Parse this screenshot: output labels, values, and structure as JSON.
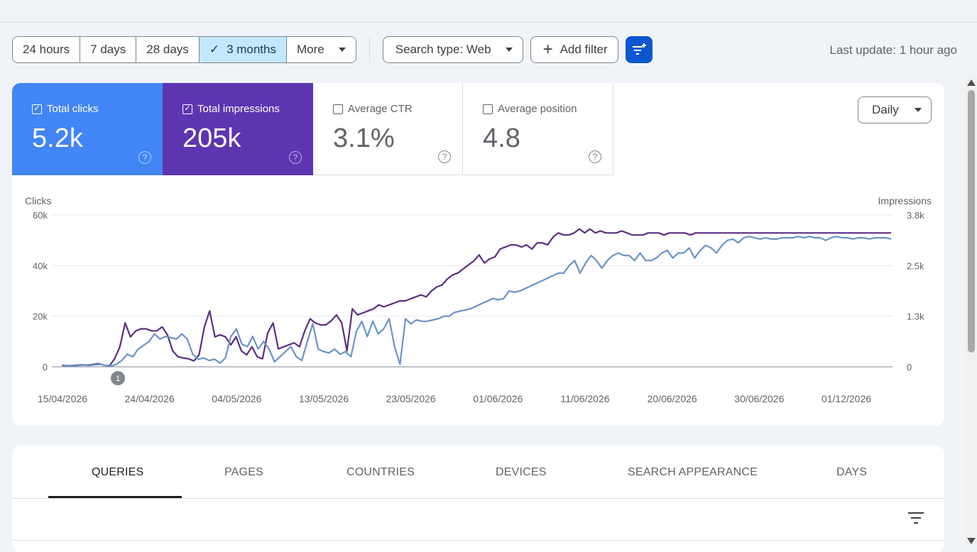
{
  "toolbar": {
    "ranges": [
      "24 hours",
      "7 days",
      "28 days",
      "3 months"
    ],
    "active_range": "3 months",
    "more_label": "More",
    "search_type_label": "Search type: Web",
    "add_filter_label": "Add filter",
    "last_update": "Last update: 1 hour ago"
  },
  "metrics": {
    "clicks": {
      "label": "Total clicks",
      "value": "5.2k",
      "checked": true,
      "color": "#4285f4"
    },
    "impressions": {
      "label": "Total impressions",
      "value": "205k",
      "checked": true,
      "color": "#5e35b1"
    },
    "ctr": {
      "label": "Average CTR",
      "value": "3.1%",
      "checked": false
    },
    "position": {
      "label": "Average position",
      "value": "4.8",
      "checked": false
    }
  },
  "granularity": "Daily",
  "chart_data": {
    "type": "line",
    "ylabel_left": "Clicks",
    "ylabel_right": "Impressions",
    "left_ticks": [
      "0",
      "20k",
      "40k",
      "60k"
    ],
    "right_ticks": [
      "0",
      "1.3k",
      "2.5k",
      "3.8k"
    ],
    "ylim_left": [
      0,
      60000
    ],
    "ylim_right": [
      0,
      3800
    ],
    "x_tick_labels": [
      "15/04/2026",
      "24/04/2026",
      "04/05/2026",
      "13/05/2026",
      "23/05/2026",
      "01/06/2026",
      "11/06/2026",
      "20/06/2026",
      "30/06/2026",
      "01/12/2026"
    ],
    "annotation": "1",
    "grid": true,
    "series": [
      {
        "name": "Total clicks",
        "color": "#6a93c8",
        "values": [
          500,
          400,
          300,
          500,
          700,
          500,
          800,
          1000,
          600,
          300,
          1000,
          2500,
          5000,
          4000,
          7000,
          8500,
          10000,
          13000,
          11000,
          12000,
          11500,
          11000,
          13000,
          11000,
          5000,
          3000,
          3500,
          2500,
          3000,
          1500,
          3500,
          12000,
          15000,
          9000,
          8000,
          12000,
          7000,
          10000,
          7000,
          2000,
          4000,
          6000,
          8000,
          4000,
          2500,
          10000,
          17000,
          7000,
          6000,
          5500,
          7000,
          5000,
          6000,
          4000,
          14000,
          18000,
          12000,
          18000,
          13000,
          15000,
          19000,
          8000,
          1000,
          19000,
          17000,
          18500,
          18000,
          18000,
          18500,
          19000,
          20000,
          20000,
          21500,
          22000,
          22500,
          23000,
          24000,
          25000,
          26000,
          27000,
          26500,
          27000,
          30000,
          29500,
          30000,
          31000,
          32000,
          33000,
          34000,
          35000,
          36000,
          37000,
          37000,
          40000,
          42000,
          37000,
          41000,
          44000,
          42000,
          39000,
          42000,
          44000,
          45000,
          44000,
          44000,
          42000,
          45000,
          42000,
          42000,
          43000,
          45000,
          46000,
          43000,
          45000,
          45000,
          47000,
          43000,
          46000,
          48000,
          47000,
          45000,
          48000,
          50000,
          50500,
          49000,
          51000,
          51500,
          51000,
          50500,
          51000,
          50500,
          50500,
          51000,
          51000,
          51000,
          51500,
          51000,
          51500,
          51000,
          51000,
          50000,
          51000,
          51500,
          51000,
          51000,
          50500,
          51000,
          51000,
          50500,
          51000,
          51000,
          51000,
          50500
        ]
      },
      {
        "name": "Total impressions",
        "color": "#5b2d82",
        "values": [
          40,
          30,
          30,
          40,
          50,
          40,
          60,
          80,
          40,
          20,
          200,
          500,
          1100,
          750,
          900,
          950,
          950,
          900,
          900,
          1000,
          800,
          400,
          250,
          220,
          200,
          150,
          300,
          1000,
          1400,
          750,
          800,
          750,
          550,
          750,
          400,
          300,
          500,
          250,
          200,
          850,
          1100,
          450,
          500,
          550,
          600,
          500,
          900,
          1200,
          1100,
          1050,
          1050,
          1150,
          1300,
          1100,
          400,
          1450,
          1300,
          1350,
          1400,
          1450,
          1550,
          1500,
          1550,
          1600,
          1650,
          1650,
          1700,
          1750,
          1800,
          1750,
          1900,
          2000,
          2050,
          2200,
          2300,
          2350,
          2450,
          2550,
          2650,
          2800,
          2600,
          2700,
          2750,
          2950,
          3000,
          3050,
          3050,
          3000,
          3050,
          2950,
          3100,
          3100,
          3050,
          3250,
          3350,
          3300,
          3300,
          3350,
          3450,
          3350,
          3450,
          3350,
          3400,
          3350,
          3350,
          3350,
          3400,
          3350,
          3300,
          3300,
          3300,
          3350,
          3350,
          3350,
          3300,
          3350,
          3350,
          3350,
          3350,
          3300,
          3350,
          3350,
          3350,
          3350,
          3350,
          3350,
          3350,
          3350,
          3350,
          3350,
          3350,
          3350,
          3350,
          3350,
          3350,
          3350,
          3350,
          3350,
          3350,
          3350,
          3350,
          3350,
          3350,
          3350,
          3350,
          3350,
          3350,
          3350,
          3350,
          3350,
          3350,
          3350,
          3350,
          3350,
          3350,
          3350,
          3350,
          3350
        ]
      }
    ]
  },
  "tabs": [
    "QUERIES",
    "PAGES",
    "COUNTRIES",
    "DEVICES",
    "SEARCH APPEARANCE",
    "DAYS"
  ],
  "active_tab": "QUERIES"
}
